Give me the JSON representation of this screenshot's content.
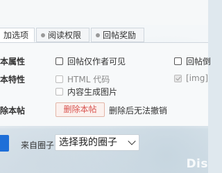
{
  "tabs": [
    {
      "label": "加选项",
      "active": true
    },
    {
      "label": "阅读权限",
      "active": false
    },
    {
      "label": "回帖奖励",
      "active": false
    }
  ],
  "rows": {
    "basic_label": "本属性",
    "feature_label": "本特性",
    "delete_label": "除本帖"
  },
  "options": {
    "reply_author_only": "回帖仅作者可见",
    "reply_cut": "回帖倒",
    "html_code": "HTML 代码",
    "img_tag": "[img]",
    "auto_image": "内容生成图片"
  },
  "delete": {
    "button_label": "删除本帖",
    "note": "删除后无法撤销"
  },
  "circle": {
    "label": "来自圈子:",
    "selected": "选择我的圈子"
  },
  "watermark": "Dis"
}
